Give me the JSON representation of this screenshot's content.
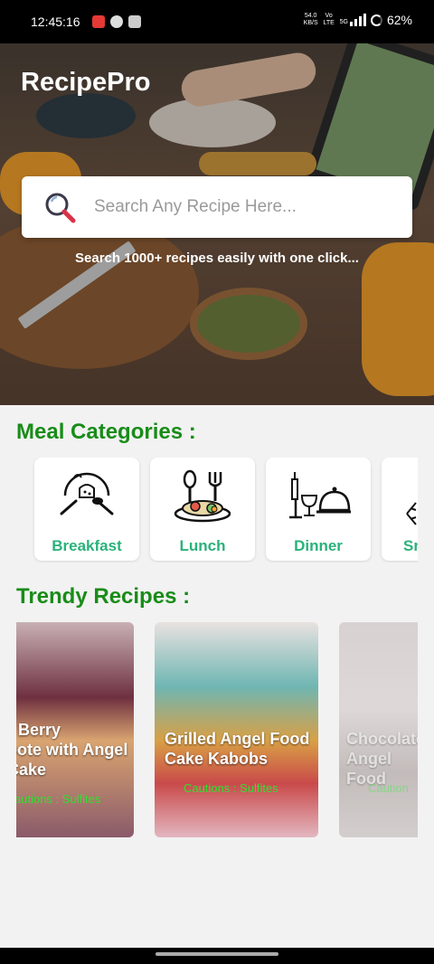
{
  "status_bar": {
    "time": "12:45:16",
    "network_speed": "54.0",
    "network_speed_unit": "KB/S",
    "volte": "Vo LTE",
    "network_type": "5G",
    "battery": "62%"
  },
  "header": {
    "app_title": "RecipePro"
  },
  "search": {
    "placeholder": "Search Any Recipe Here...",
    "caption": "Search 1000+ recipes easily with one click..."
  },
  "categories": {
    "title": "Meal Categories :",
    "items": [
      {
        "label": "Breakfast",
        "icon": "breakfast-icon"
      },
      {
        "label": "Lunch",
        "icon": "lunch-icon"
      },
      {
        "label": "Dinner",
        "icon": "dinner-icon"
      },
      {
        "label": "Sr",
        "icon": "snack-icon"
      }
    ]
  },
  "trendy": {
    "title": "Trendy Recipes :",
    "recipes": [
      {
        "title_line1": "r Berry",
        "title_line2": "pote with Angel",
        "title_line3": "Cake",
        "tags": "autions : Sulfites"
      },
      {
        "title_line1": "Grilled Angel Food",
        "title_line2": "Cake Kabobs",
        "tags": "Cautions : Sulfites"
      },
      {
        "title_line1": "Chocolate",
        "title_line2": "Angel Food",
        "tags": "Caution"
      }
    ]
  },
  "colors": {
    "section_title": "#188c18",
    "category_label": "#2ab27b",
    "tag_text": "#30e030"
  }
}
